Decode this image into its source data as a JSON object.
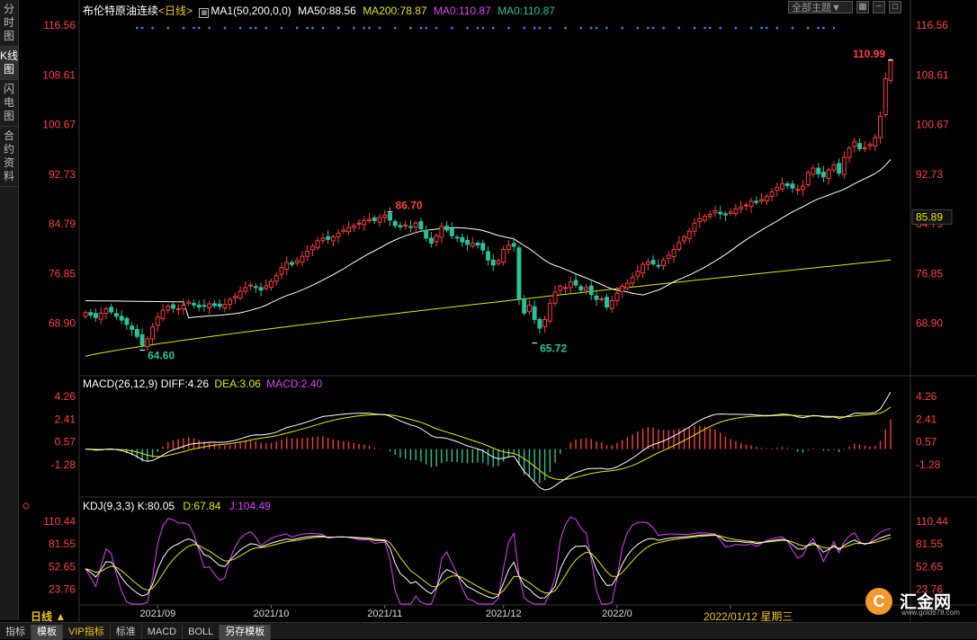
{
  "side_tabs": [
    "分时图",
    "K线图",
    "闪电图",
    "合约资料"
  ],
  "header": {
    "symbol": "布伦特原油连续",
    "period_tag": "<日线>",
    "ma_params": "MA1(50,200,0,0)",
    "ma50": "MA50:88.56",
    "ma200": "MA200:78.87",
    "ma0a": "MA0:110.87",
    "ma0b": "MA0:110.87"
  },
  "theme_select": "全部主题▼",
  "macd_header": {
    "params": "MACD(26,12,9)",
    "diff": "DIFF:4.26",
    "dea": "DEA:3.06",
    "macd": "MACD:2.40"
  },
  "kdj_header": {
    "params": "KDJ(9,3,3)",
    "k": "K:80.05",
    "d": "D:67.84",
    "j": "J:104.49"
  },
  "bottom_tabs": [
    "指标",
    "模板",
    "VIP指标",
    "标准",
    "MACD",
    "BOLL",
    "另存模板"
  ],
  "period_label": "日线 ▲",
  "date_tip": "2022/01/12 星期三",
  "logo": {
    "name": "汇金网",
    "site": "www.gold678.com"
  },
  "colors": {
    "up": "#ff3b3b",
    "down": "#27c29b",
    "ma50": "#ffffff",
    "ma200": "#e6e600",
    "diff": "#ffffff",
    "dea": "#e6e600",
    "k": "#ffffff",
    "d": "#e6e600",
    "j": "#e040fb",
    "text_red": "#ff4040"
  },
  "chart_data": [
    {
      "type": "candlestick",
      "title": "布伦特原油连续 日线",
      "y_ticks": [
        116.56,
        108.61,
        100.67,
        92.73,
        84.79,
        76.85,
        68.9
      ],
      "ylim": [
        60.5,
        118.0
      ],
      "x_ticks": [
        "2021/09",
        "2021/10",
        "2021/11",
        "2021/12",
        "2022/0",
        "/02"
      ],
      "last_price": 85.89,
      "annotations": [
        {
          "label": "110.99",
          "value": 110.99,
          "kind": "high"
        },
        {
          "label": "86.70",
          "value": 86.7,
          "kind": "high"
        },
        {
          "label": "64.60",
          "value": 64.6,
          "kind": "low"
        },
        {
          "label": "65.72",
          "value": 65.72,
          "kind": "low"
        }
      ],
      "close": [
        70.6,
        70.2,
        69.8,
        70.5,
        71.2,
        70.7,
        70.0,
        69.4,
        68.7,
        67.9,
        66.8,
        65.4,
        66.4,
        68.3,
        69.9,
        71.0,
        71.6,
        71.3,
        71.2,
        71.8,
        72.3,
        71.8,
        71.5,
        71.6,
        72.0,
        71.7,
        71.6,
        71.9,
        72.7,
        73.2,
        74.0,
        74.6,
        75.0,
        74.6,
        74.2,
        74.9,
        75.6,
        76.5,
        77.8,
        78.6,
        78.3,
        78.9,
        79.6,
        80.4,
        81.2,
        82.1,
        82.5,
        82.3,
        82.7,
        83.3,
        83.8,
        84.2,
        84.5,
        84.9,
        85.3,
        85.5,
        85.3,
        85.8,
        86.2,
        85.4,
        84.5,
        84.3,
        84.6,
        84.3,
        84.9,
        84.0,
        82.5,
        81.7,
        82.9,
        84.4,
        83.8,
        82.9,
        82.6,
        81.9,
        81.5,
        81.7,
        81.4,
        80.6,
        79.0,
        78.2,
        78.9,
        80.7,
        81.4,
        81.2,
        72.8,
        70.5,
        71.8,
        69.5,
        68.1,
        69.5,
        72.1,
        73.9,
        74.8,
        74.6,
        75.5,
        75.0,
        74.2,
        74.6,
        73.5,
        72.7,
        72.8,
        71.5,
        72.5,
        73.7,
        74.8,
        75.3,
        76.2,
        77.2,
        78.3,
        78.7,
        78.4,
        78.1,
        79.0,
        79.8,
        80.7,
        81.8,
        82.7,
        83.6,
        84.9,
        85.6,
        86.0,
        86.3,
        86.9,
        86.4,
        86.2,
        86.7,
        87.2,
        87.5,
        87.8,
        88.4,
        88.2,
        88.7,
        89.2,
        89.9,
        90.6,
        91.2,
        90.9,
        90.5,
        90.3,
        90.8,
        93.0,
        93.7,
        92.8,
        92.3,
        93.4,
        94.2,
        92.9,
        95.4,
        96.9,
        97.9,
        96.8,
        97.0,
        97.5,
        98.6,
        102.0,
        108.0,
        110.9
      ]
    },
    {
      "type": "line",
      "title": "MACD(26,12,9)",
      "y_ticks": [
        4.26,
        2.41,
        0.57,
        -1.28
      ],
      "ylim": [
        -3.8,
        4.9
      ]
    },
    {
      "type": "line",
      "title": "KDJ(9,3,3)",
      "y_ticks": [
        110.44,
        81.55,
        52.65,
        23.76
      ],
      "ylim": [
        5,
        124
      ]
    }
  ]
}
